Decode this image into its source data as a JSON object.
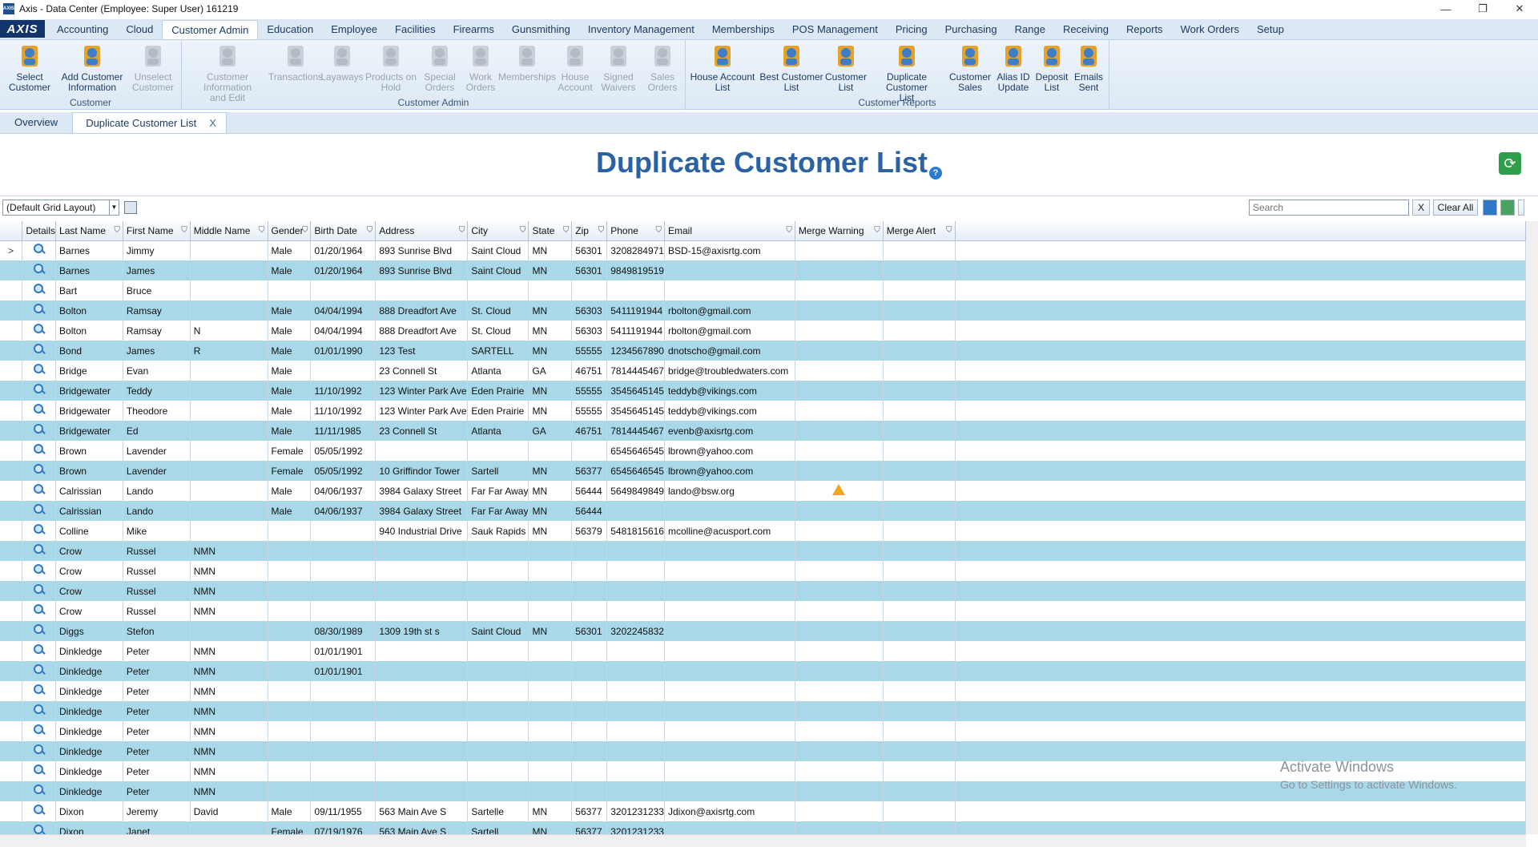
{
  "window": {
    "title": "Axis - Data Center  (Employee: Super User) 161219",
    "controls": [
      "—",
      "❐",
      "✕"
    ]
  },
  "menu": {
    "logo": "AXIS",
    "tabs": [
      "Accounting",
      "Cloud",
      "Customer Admin",
      "Education",
      "Employee",
      "Facilities",
      "Firearms",
      "Gunsmithing",
      "Inventory Management",
      "Memberships",
      "POS Management",
      "Pricing",
      "Purchasing",
      "Range",
      "Receiving",
      "Reports",
      "Work Orders",
      "Setup"
    ],
    "active_index": 2
  },
  "ribbon": {
    "groups": [
      {
        "label": "Customer",
        "buttons": [
          {
            "l1": "Select",
            "l2": "Customer",
            "icon": "person-icon",
            "enabled": true
          },
          {
            "l1": "Add Customer",
            "l2": "Information",
            "icon": "add-person-icon",
            "enabled": true
          },
          {
            "l1": "Unselect",
            "l2": "Customer",
            "icon": "x-icon",
            "enabled": false
          }
        ]
      },
      {
        "label": "Customer Admin",
        "buttons": [
          {
            "l1": "Customer Information",
            "l2": "and Edit",
            "icon": "person-edit-icon",
            "enabled": false
          },
          {
            "l1": "Transactions",
            "l2": "",
            "icon": "arrows-icon",
            "enabled": false
          },
          {
            "l1": "Layaways",
            "l2": "",
            "icon": "calendar-icon",
            "enabled": false
          },
          {
            "l1": "Products on",
            "l2": "Hold",
            "icon": "hold-icon",
            "enabled": false
          },
          {
            "l1": "Special",
            "l2": "Orders",
            "icon": "tag-icon",
            "enabled": false
          },
          {
            "l1": "Work",
            "l2": "Orders",
            "icon": "tools-icon",
            "enabled": false
          },
          {
            "l1": "Memberships",
            "l2": "",
            "icon": "people-icon",
            "enabled": false
          },
          {
            "l1": "House",
            "l2": "Account",
            "icon": "house-icon",
            "enabled": false
          },
          {
            "l1": "Signed",
            "l2": "Waivers",
            "icon": "waiver-icon",
            "enabled": false
          },
          {
            "l1": "Sales",
            "l2": "Orders",
            "icon": "document-icon",
            "enabled": false
          }
        ]
      },
      {
        "label": "Customer Reports",
        "buttons": [
          {
            "l1": "House Account",
            "l2": "List",
            "icon": "house-list-icon",
            "enabled": true
          },
          {
            "l1": "Best Customer",
            "l2": "List",
            "icon": "star-list-icon",
            "enabled": true
          },
          {
            "l1": "Customer",
            "l2": "List",
            "icon": "clipboard-icon",
            "enabled": true
          },
          {
            "l1": "Duplicate Customer",
            "l2": "List",
            "icon": "duplicate-people-icon",
            "enabled": true
          },
          {
            "l1": "Customer",
            "l2": "Sales",
            "icon": "money-person-icon",
            "enabled": true
          },
          {
            "l1": "Alias ID",
            "l2": "Update",
            "icon": "id-icon",
            "enabled": true
          },
          {
            "l1": "Deposit",
            "l2": "List",
            "icon": "deposit-icon",
            "enabled": true
          },
          {
            "l1": "Emails",
            "l2": "Sent",
            "icon": "email-icon",
            "enabled": true
          }
        ]
      }
    ]
  },
  "doc_tabs": {
    "overview": "Overview",
    "active": "Duplicate Customer List",
    "close": "X"
  },
  "page": {
    "title": "Duplicate Customer List",
    "help": "?"
  },
  "toolbar": {
    "layout": "(Default Grid Layout)",
    "search_placeholder": "Search",
    "clear_x": "X",
    "clear_all": "Clear All"
  },
  "grid": {
    "columns": [
      "Details",
      "Last Name",
      "First Name",
      "Middle Name",
      "Gender",
      "Birth Date",
      "Address",
      "City",
      "State",
      "Zip",
      "Phone",
      "Email",
      "Merge Warning",
      "Merge Alert"
    ],
    "rows": [
      [
        "Barnes",
        "Jimmy",
        "",
        "Male",
        "01/20/1964",
        "893 Sunrise Blvd",
        "Saint Cloud",
        "MN",
        "56301",
        "3208284971",
        "BSD-15@axisrtg.com",
        ""
      ],
      [
        "Barnes",
        "James",
        "",
        "Male",
        "01/20/1964",
        "893 Sunrise Blvd",
        "Saint Cloud",
        "MN",
        "56301",
        "9849819519",
        "",
        ""
      ],
      [
        "Bart",
        "Bruce",
        "",
        "",
        "",
        "",
        "",
        "",
        "",
        "",
        "",
        ""
      ],
      [
        "Bolton",
        "Ramsay",
        "",
        "Male",
        "04/04/1994",
        "888 Dreadfort Ave",
        "St. Cloud",
        "MN",
        "56303",
        "5411191944",
        "rbolton@gmail.com",
        ""
      ],
      [
        "Bolton",
        "Ramsay",
        "N",
        "Male",
        "04/04/1994",
        "888 Dreadfort Ave",
        "St. Cloud",
        "MN",
        "56303",
        "5411191944",
        "rbolton@gmail.com",
        ""
      ],
      [
        "Bond",
        "James",
        "R",
        "Male",
        "01/01/1990",
        "123 Test",
        "SARTELL",
        "MN",
        "55555",
        "1234567890",
        "dnotscho@gmail.com",
        ""
      ],
      [
        "Bridge",
        "Evan",
        "",
        "Male",
        "",
        "23 Connell St",
        "Atlanta",
        "GA",
        "46751",
        "7814445467",
        "bridge@troubledwaters.com",
        ""
      ],
      [
        "Bridgewater",
        "Teddy",
        "",
        "Male",
        "11/10/1992",
        "123 Winter Park Ave",
        "Eden Prairie",
        "MN",
        "55555",
        "3545645145",
        "teddyb@vikings.com",
        ""
      ],
      [
        "Bridgewater",
        "Theodore",
        "",
        "Male",
        "11/10/1992",
        "123 Winter Park Ave",
        "Eden Prairie",
        "MN",
        "55555",
        "3545645145",
        "teddyb@vikings.com",
        ""
      ],
      [
        "Bridgewater",
        "Ed",
        "",
        "Male",
        "11/11/1985",
        "23 Connell St",
        "Atlanta",
        "GA",
        "46751",
        "7814445467",
        "evenb@axisrtg.com",
        ""
      ],
      [
        "Brown",
        "Lavender",
        "",
        "Female",
        "05/05/1992",
        "",
        "",
        "",
        "",
        "6545646545",
        "lbrown@yahoo.com",
        ""
      ],
      [
        "Brown",
        "Lavender",
        "",
        "Female",
        "05/05/1992",
        "10 Griffindor Tower",
        "Sartell",
        "MN",
        "56377",
        "6545646545",
        "lbrown@yahoo.com",
        ""
      ],
      [
        "Calrissian",
        "Lando",
        "",
        "Male",
        "04/06/1937",
        "3984 Galaxy Street",
        "Far Far Away",
        "MN",
        "56444",
        "5649849849",
        "lando@bsw.org",
        "warn"
      ],
      [
        "Calrissian",
        "Lando",
        "",
        "Male",
        "04/06/1937",
        "3984 Galaxy Street",
        "Far Far Away",
        "MN",
        "56444",
        "",
        "",
        ""
      ],
      [
        "Colline",
        "Mike",
        "",
        "",
        "",
        "940 Industrial Drive",
        "Sauk Rapids",
        "MN",
        "56379",
        "5481815616",
        "mcolline@acusport.com",
        ""
      ],
      [
        "Crow",
        "Russel",
        "NMN",
        "",
        "",
        "",
        "",
        "",
        "",
        "",
        "",
        ""
      ],
      [
        "Crow",
        "Russel",
        "NMN",
        "",
        "",
        "",
        "",
        "",
        "",
        "",
        "",
        ""
      ],
      [
        "Crow",
        "Russel",
        "NMN",
        "",
        "",
        "",
        "",
        "",
        "",
        "",
        "",
        ""
      ],
      [
        "Crow",
        "Russel",
        "NMN",
        "",
        "",
        "",
        "",
        "",
        "",
        "",
        "",
        ""
      ],
      [
        "Diggs",
        "Stefon",
        "",
        "",
        "08/30/1989",
        "1309 19th st s",
        "Saint Cloud",
        "MN",
        "56301",
        "3202245832",
        "",
        ""
      ],
      [
        "Dinkledge",
        "Peter",
        "NMN",
        "",
        "01/01/1901",
        "",
        "",
        "",
        "",
        "",
        "",
        ""
      ],
      [
        "Dinkledge",
        "Peter",
        "NMN",
        "",
        "01/01/1901",
        "",
        "",
        "",
        "",
        "",
        "",
        ""
      ],
      [
        "Dinkledge",
        "Peter",
        "NMN",
        "",
        "",
        "",
        "",
        "",
        "",
        "",
        "",
        ""
      ],
      [
        "Dinkledge",
        "Peter",
        "NMN",
        "",
        "",
        "",
        "",
        "",
        "",
        "",
        "",
        ""
      ],
      [
        "Dinkledge",
        "Peter",
        "NMN",
        "",
        "",
        "",
        "",
        "",
        "",
        "",
        "",
        ""
      ],
      [
        "Dinkledge",
        "Peter",
        "NMN",
        "",
        "",
        "",
        "",
        "",
        "",
        "",
        "",
        ""
      ],
      [
        "Dinkledge",
        "Peter",
        "NMN",
        "",
        "",
        "",
        "",
        "",
        "",
        "",
        "",
        ""
      ],
      [
        "Dinkledge",
        "Peter",
        "NMN",
        "",
        "",
        "",
        "",
        "",
        "",
        "",
        "",
        ""
      ],
      [
        "Dixon",
        "Jeremy",
        "David",
        "Male",
        "09/11/1955",
        "563 Main Ave S",
        "Sartelle",
        "MN",
        "56377",
        "3201231233",
        "Jdixon@axisrtg.com",
        ""
      ],
      [
        "Dixon",
        "Janet",
        "",
        "Female",
        "07/19/1976",
        "563 Main Ave S",
        "Sartell",
        "MN",
        "56377",
        "3201231233",
        "",
        ""
      ]
    ]
  },
  "watermark": {
    "line1": "Activate Windows",
    "line2": "Go to Settings to activate Windows."
  }
}
